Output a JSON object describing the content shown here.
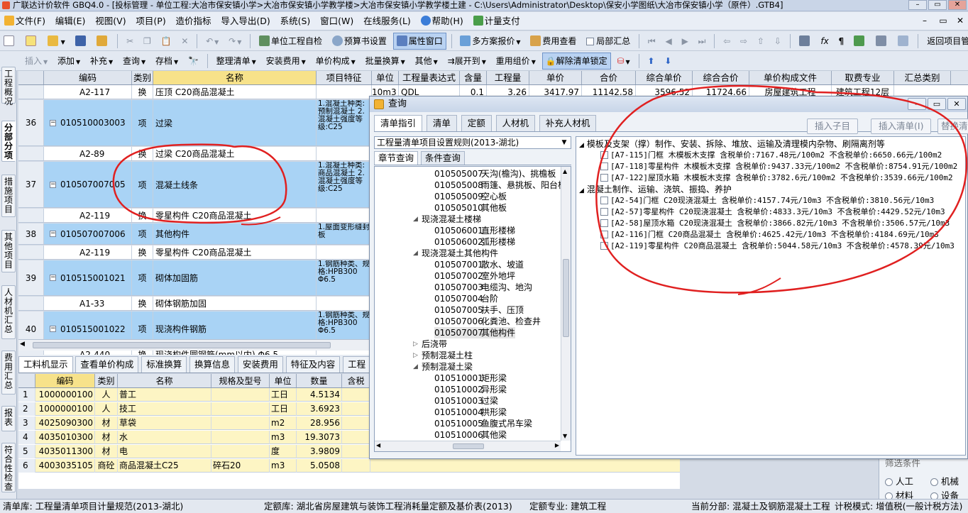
{
  "window": {
    "title": "广联达计价软件 GBQ4.0 - [投标管理 - 单位工程:大冶市保安镇小学>大冶市保安镇小学教学楼>大冶市保安镇小学教学楼土建 - C:\\Users\\Administrator\\Desktop\\保安小学图纸\\大冶市保安镇小学（原件）.GTB4]",
    "min": "–",
    "max": "▭",
    "close": "✕"
  },
  "menu": [
    "文件(F)",
    "编辑(E)",
    "视图(V)",
    "项目(P)",
    "造价指标",
    "导入导出(D)",
    "系统(S)",
    "窗口(W)",
    "在线服务(L)",
    "帮助(H)",
    "计量支付"
  ],
  "toolbar1": {
    "unit_check": "单位工程自检",
    "budget_setting": "预算书设置",
    "property_window": "属性窗口",
    "multi_quote": "多方案报价",
    "fee_view": "费用查看",
    "partial_summary": "局部汇总",
    "return_project": "返回项目管理"
  },
  "toolbar2": {
    "insert": "插入",
    "add": "添加",
    "supplement": "补充",
    "query": "查询",
    "save": "存档",
    "organize": "整理清单",
    "install_fee": "安装费用",
    "unit_composition": "单价构成",
    "batch_convert": "批量换算",
    "other": "其他",
    "expand": "展开到",
    "reuse": "重用组价",
    "unlock": "解除清单锁定"
  },
  "sidetabs": [
    "工程概况",
    "分部分项",
    "措施项目",
    "其他项目",
    "人材机汇总",
    "费用汇总",
    "报表",
    "符合性检查"
  ],
  "grid": {
    "headers": [
      "编码",
      "类别",
      "名称",
      "项目特征",
      "单位",
      "工程量表达式",
      "含量",
      "工程量",
      "单价",
      "合价",
      "综合单价",
      "综合合价",
      "单价构成文件",
      "取费专业",
      "汇总类别"
    ],
    "top_row": {
      "code": "A2-117",
      "type": "换",
      "name": "压顶 C20商品混凝土",
      "unit": "10m3",
      "expr": "QDL",
      "content": "0.1",
      "qty": "3.26",
      "price": "3417.97",
      "total": "11142.58",
      "comp_price": "3596.52",
      "comp_total": "11724.66",
      "file": "房屋建筑工程",
      "major": "建筑工程12层"
    },
    "rows": [
      {
        "num": "36",
        "code": "010510003003",
        "type": "项",
        "name": "过梁",
        "feat": "1.混凝土种类:预制混凝土 2.混凝土强度等级:C25"
      },
      {
        "num": "",
        "code": "A2-89",
        "type": "换",
        "name": "过梁 C20商品混凝土",
        "feat": ""
      },
      {
        "num": "37",
        "code": "010507007005",
        "type": "项",
        "name": "混凝土线条",
        "feat": "1.混凝土种类:商品混凝土 2.混凝土强度等级:C25"
      },
      {
        "num": "",
        "code": "A2-119",
        "type": "换",
        "name": "零星构件 C20商品混凝土",
        "feat": ""
      },
      {
        "num": "38",
        "code": "010507007006",
        "type": "项",
        "name": "其他构件",
        "feat": "1.屋面变形缝封板"
      },
      {
        "num": "",
        "code": "A2-119",
        "type": "换",
        "name": "零星构件 C20商品混凝土",
        "feat": ""
      },
      {
        "num": "39",
        "code": "010515001021",
        "type": "项",
        "name": "砌体加固筋",
        "feat": "1.钢筋种类、规格:HPB300 Φ6.5"
      },
      {
        "num": "",
        "code": "A1-33",
        "type": "换",
        "name": "砌体钢筋加固",
        "feat": ""
      },
      {
        "num": "40",
        "code": "010515001022",
        "type": "项",
        "name": "现浇构件钢筋",
        "feat": "1.钢筋种类、规格:HPB300 Φ6.5"
      },
      {
        "num": "",
        "code": "A2-440",
        "type": "换",
        "name": "现浇构件圆钢筋(mm以内) Φ6.5",
        "feat": ""
      }
    ]
  },
  "bottom": {
    "tabs": [
      "工料机显示",
      "查看单价构成",
      "标准换算",
      "换算信息",
      "安装费用",
      "特征及内容",
      "工程"
    ],
    "headers": [
      "编码",
      "类别",
      "名称",
      "规格及型号",
      "单位",
      "数量",
      "含税"
    ],
    "rows": [
      {
        "idx": "1",
        "code": "1000000100",
        "type": "人",
        "name": "普工",
        "spec": "",
        "unit": "工日",
        "qty": "4.5134"
      },
      {
        "idx": "2",
        "code": "1000000100",
        "type": "人",
        "name": "技工",
        "spec": "",
        "unit": "工日",
        "qty": "3.6923"
      },
      {
        "idx": "3",
        "code": "4025090300",
        "type": "材",
        "name": "草袋",
        "spec": "",
        "unit": "m2",
        "qty": "28.956"
      },
      {
        "idx": "4",
        "code": "4035010300",
        "type": "材",
        "name": "水",
        "spec": "",
        "unit": "m3",
        "qty": "19.3073"
      },
      {
        "idx": "5",
        "code": "4035011300",
        "type": "材",
        "name": "电",
        "spec": "",
        "unit": "度",
        "qty": "3.9809"
      },
      {
        "idx": "6",
        "code": "4003035105",
        "type": "商砼",
        "name": "商品混凝土C25",
        "spec": "碎石20",
        "unit": "m3",
        "qty": "5.0508"
      }
    ]
  },
  "rightfilter": {
    "labor": "人工",
    "machine": "机械",
    "material": "材料",
    "equipment": "设备",
    "condition": "筛选条件"
  },
  "status": {
    "qd": "清单库: 工程量清单项目计量规范(2013-湖北)",
    "de": "定额库: 湖北省房屋建筑与装饰工程消耗量定额及基价表(2013)",
    "major": "定额专业: 建筑工程",
    "section": "当前分部: 混凝土及钢筋混凝土工程",
    "mode": "计税模式: 增值税(一般计税方法)"
  },
  "dialog": {
    "title": "查询",
    "tabs": [
      "清单指引",
      "清单",
      "定额",
      "人材机",
      "补充人材机"
    ],
    "buttons": [
      "插入子目",
      "插入清单(I)",
      "替换清单"
    ],
    "rule": "工程量清单项目设置规则(2013-湖北)",
    "subtabs": [
      "章节查询",
      "条件查询"
    ],
    "tree": [
      {
        "code": "010505007",
        "name": "天沟(檐沟)、挑檐板",
        "level": 2
      },
      {
        "code": "010505008",
        "name": "雨篷、悬挑板、阳台板",
        "level": 2
      },
      {
        "code": "010505009",
        "name": "空心板",
        "level": 2
      },
      {
        "code": "010505010",
        "name": "其他板",
        "level": 2
      },
      {
        "code": "",
        "name": "现浇混凝土楼梯",
        "level": 1
      },
      {
        "code": "010506001",
        "name": "直形楼梯",
        "level": 2
      },
      {
        "code": "010506002",
        "name": "弧形楼梯",
        "level": 2
      },
      {
        "code": "",
        "name": "现浇混凝土其他构件",
        "level": 1
      },
      {
        "code": "010507001",
        "name": "散水、坡道",
        "level": 2
      },
      {
        "code": "010507002",
        "name": "室外地坪",
        "level": 2
      },
      {
        "code": "010507003",
        "name": "电缆沟、地沟",
        "level": 2
      },
      {
        "code": "010507004",
        "name": "台阶",
        "level": 2
      },
      {
        "code": "010507005",
        "name": "扶手、压顶",
        "level": 2
      },
      {
        "code": "010507006",
        "name": "化粪池、检查井",
        "level": 2
      },
      {
        "code": "010507007",
        "name": "其他构件",
        "level": 2,
        "hl": true
      },
      {
        "code": "",
        "name": "后浇带",
        "level": 1,
        "collapsed": true
      },
      {
        "code": "",
        "name": "预制混凝土柱",
        "level": 1,
        "collapsed": true
      },
      {
        "code": "",
        "name": "预制混凝土梁",
        "level": 1
      },
      {
        "code": "010510001",
        "name": "矩形梁",
        "level": 2
      },
      {
        "code": "010510002",
        "name": "异形梁",
        "level": 2
      },
      {
        "code": "010510003",
        "name": "过梁",
        "level": 2
      },
      {
        "code": "010510004",
        "name": "拱形梁",
        "level": 2
      },
      {
        "code": "010510005",
        "name": "鱼腹式吊车梁",
        "level": 2
      },
      {
        "code": "010510006",
        "name": "其他梁",
        "level": 2
      }
    ],
    "groups": [
      {
        "title": "模板及支架（撑）制作、安装、拆除、堆放、运输及清理模内杂物、刷隔离剂等",
        "items": [
          "[A7-115]门框 木模板木支撑 含税单价:7167.48元/100m2 不含税单价:6650.66元/100m2",
          "[A7-118]零星构件 木模板木支撑 含税单价:9437.33元/100m2 不含税单价:8754.91元/100m2",
          "[A7-122]屋顶水箱 木模板木支撑 含税单价:3782.6元/100m2 不含税单价:3539.66元/100m2"
        ]
      },
      {
        "title": "混凝土制作、运输、浇筑、振捣、养护",
        "items": [
          "[A2-54]门框 C20现浇混凝土 含税单价:4157.74元/10m3 不含税单价:3810.56元/10m3",
          "[A2-57]零星构件 C20现浇混凝土 含税单价:4833.3元/10m3 不含税单价:4429.52元/10m3",
          "[A2-58]屋顶水箱 C20现浇混凝土 含税单价:3866.82元/10m3 不含税单价:3506.57元/10m3",
          "[A2-116]门框 C20商品混凝土 含税单价:4625.42元/10m3 不含税单价:4184.69元/10m3",
          "[A2-119]零星构件 C20商品混凝土 含税单价:5044.58元/10m3 不含税单价:4578.39元/10m3"
        ]
      }
    ]
  }
}
